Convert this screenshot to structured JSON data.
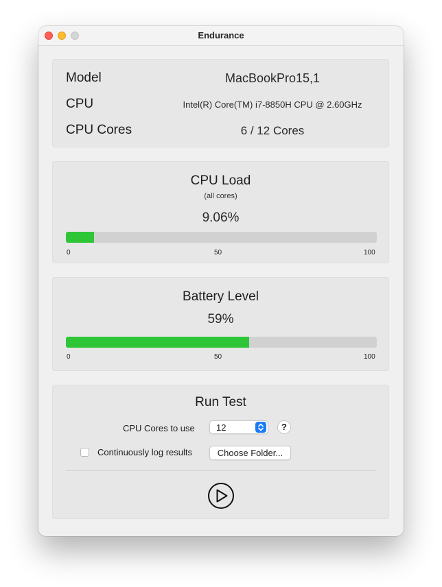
{
  "window": {
    "title": "Endurance"
  },
  "info": {
    "model_label": "Model",
    "model_value": "MacBookPro15,1",
    "cpu_label": "CPU",
    "cpu_value": "Intel(R) Core(TM) i7-8850H CPU @ 2.60GHz",
    "cores_label": "CPU Cores",
    "cores_value": "6 / 12 Cores"
  },
  "cpu_load": {
    "title": "CPU Load",
    "subtitle": "(all cores)",
    "value_text": "9.06%",
    "value": 9.06,
    "scale": [
      "0",
      "50",
      "100"
    ],
    "bar_color": "#2ec637"
  },
  "battery": {
    "title": "Battery Level",
    "value_text": "59%",
    "value": 59,
    "scale": [
      "0",
      "50",
      "100"
    ],
    "bar_color": "#2ec637"
  },
  "run_test": {
    "title": "Run Test",
    "cores_label": "CPU Cores to use",
    "cores_selected": "12",
    "help_label": "?",
    "log_label": "Continuously log results",
    "log_checked": false,
    "choose_folder_label": "Choose Folder...",
    "play_icon": "play-circle-icon"
  }
}
